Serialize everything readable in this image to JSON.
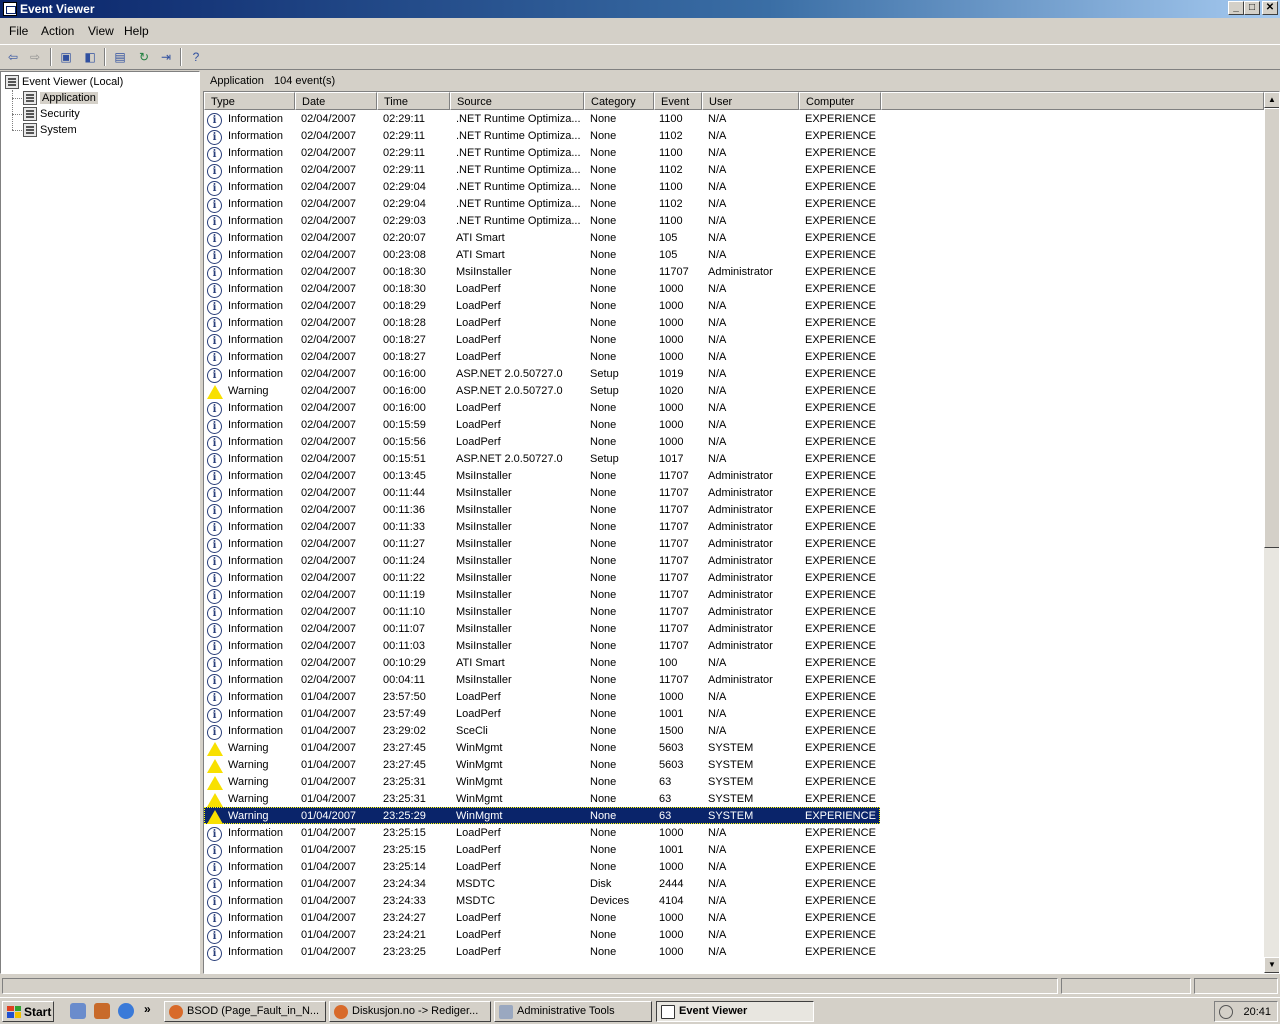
{
  "window": {
    "title": "Event Viewer",
    "min": "_",
    "max": "□",
    "close": "✕"
  },
  "menu": [
    "File",
    "Action",
    "View",
    "Help"
  ],
  "tree": {
    "root": "Event Viewer (Local)",
    "items": [
      "Application",
      "Security",
      "System"
    ],
    "selected": "Application"
  },
  "header": {
    "log": "Application",
    "count": "104 event(s)"
  },
  "columns": [
    "Type",
    "Date",
    "Time",
    "Source",
    "Category",
    "Event",
    "User",
    "Computer"
  ],
  "events": [
    [
      "Information",
      "02/04/2007",
      "02:29:11",
      ".NET Runtime Optimiza...",
      "None",
      "1100",
      "N/A",
      "EXPERIENCE"
    ],
    [
      "Information",
      "02/04/2007",
      "02:29:11",
      ".NET Runtime Optimiza...",
      "None",
      "1102",
      "N/A",
      "EXPERIENCE"
    ],
    [
      "Information",
      "02/04/2007",
      "02:29:11",
      ".NET Runtime Optimiza...",
      "None",
      "1100",
      "N/A",
      "EXPERIENCE"
    ],
    [
      "Information",
      "02/04/2007",
      "02:29:11",
      ".NET Runtime Optimiza...",
      "None",
      "1102",
      "N/A",
      "EXPERIENCE"
    ],
    [
      "Information",
      "02/04/2007",
      "02:29:04",
      ".NET Runtime Optimiza...",
      "None",
      "1100",
      "N/A",
      "EXPERIENCE"
    ],
    [
      "Information",
      "02/04/2007",
      "02:29:04",
      ".NET Runtime Optimiza...",
      "None",
      "1102",
      "N/A",
      "EXPERIENCE"
    ],
    [
      "Information",
      "02/04/2007",
      "02:29:03",
      ".NET Runtime Optimiza...",
      "None",
      "1100",
      "N/A",
      "EXPERIENCE"
    ],
    [
      "Information",
      "02/04/2007",
      "02:20:07",
      "ATI Smart",
      "None",
      "105",
      "N/A",
      "EXPERIENCE"
    ],
    [
      "Information",
      "02/04/2007",
      "00:23:08",
      "ATI Smart",
      "None",
      "105",
      "N/A",
      "EXPERIENCE"
    ],
    [
      "Information",
      "02/04/2007",
      "00:18:30",
      "MsiInstaller",
      "None",
      "11707",
      "Administrator",
      "EXPERIENCE"
    ],
    [
      "Information",
      "02/04/2007",
      "00:18:30",
      "LoadPerf",
      "None",
      "1000",
      "N/A",
      "EXPERIENCE"
    ],
    [
      "Information",
      "02/04/2007",
      "00:18:29",
      "LoadPerf",
      "None",
      "1000",
      "N/A",
      "EXPERIENCE"
    ],
    [
      "Information",
      "02/04/2007",
      "00:18:28",
      "LoadPerf",
      "None",
      "1000",
      "N/A",
      "EXPERIENCE"
    ],
    [
      "Information",
      "02/04/2007",
      "00:18:27",
      "LoadPerf",
      "None",
      "1000",
      "N/A",
      "EXPERIENCE"
    ],
    [
      "Information",
      "02/04/2007",
      "00:18:27",
      "LoadPerf",
      "None",
      "1000",
      "N/A",
      "EXPERIENCE"
    ],
    [
      "Information",
      "02/04/2007",
      "00:16:00",
      "ASP.NET 2.0.50727.0",
      "Setup",
      "1019",
      "N/A",
      "EXPERIENCE"
    ],
    [
      "Warning",
      "02/04/2007",
      "00:16:00",
      "ASP.NET 2.0.50727.0",
      "Setup",
      "1020",
      "N/A",
      "EXPERIENCE"
    ],
    [
      "Information",
      "02/04/2007",
      "00:16:00",
      "LoadPerf",
      "None",
      "1000",
      "N/A",
      "EXPERIENCE"
    ],
    [
      "Information",
      "02/04/2007",
      "00:15:59",
      "LoadPerf",
      "None",
      "1000",
      "N/A",
      "EXPERIENCE"
    ],
    [
      "Information",
      "02/04/2007",
      "00:15:56",
      "LoadPerf",
      "None",
      "1000",
      "N/A",
      "EXPERIENCE"
    ],
    [
      "Information",
      "02/04/2007",
      "00:15:51",
      "ASP.NET 2.0.50727.0",
      "Setup",
      "1017",
      "N/A",
      "EXPERIENCE"
    ],
    [
      "Information",
      "02/04/2007",
      "00:13:45",
      "MsiInstaller",
      "None",
      "11707",
      "Administrator",
      "EXPERIENCE"
    ],
    [
      "Information",
      "02/04/2007",
      "00:11:44",
      "MsiInstaller",
      "None",
      "11707",
      "Administrator",
      "EXPERIENCE"
    ],
    [
      "Information",
      "02/04/2007",
      "00:11:36",
      "MsiInstaller",
      "None",
      "11707",
      "Administrator",
      "EXPERIENCE"
    ],
    [
      "Information",
      "02/04/2007",
      "00:11:33",
      "MsiInstaller",
      "None",
      "11707",
      "Administrator",
      "EXPERIENCE"
    ],
    [
      "Information",
      "02/04/2007",
      "00:11:27",
      "MsiInstaller",
      "None",
      "11707",
      "Administrator",
      "EXPERIENCE"
    ],
    [
      "Information",
      "02/04/2007",
      "00:11:24",
      "MsiInstaller",
      "None",
      "11707",
      "Administrator",
      "EXPERIENCE"
    ],
    [
      "Information",
      "02/04/2007",
      "00:11:22",
      "MsiInstaller",
      "None",
      "11707",
      "Administrator",
      "EXPERIENCE"
    ],
    [
      "Information",
      "02/04/2007",
      "00:11:19",
      "MsiInstaller",
      "None",
      "11707",
      "Administrator",
      "EXPERIENCE"
    ],
    [
      "Information",
      "02/04/2007",
      "00:11:10",
      "MsiInstaller",
      "None",
      "11707",
      "Administrator",
      "EXPERIENCE"
    ],
    [
      "Information",
      "02/04/2007",
      "00:11:07",
      "MsiInstaller",
      "None",
      "11707",
      "Administrator",
      "EXPERIENCE"
    ],
    [
      "Information",
      "02/04/2007",
      "00:11:03",
      "MsiInstaller",
      "None",
      "11707",
      "Administrator",
      "EXPERIENCE"
    ],
    [
      "Information",
      "02/04/2007",
      "00:10:29",
      "ATI Smart",
      "None",
      "100",
      "N/A",
      "EXPERIENCE"
    ],
    [
      "Information",
      "02/04/2007",
      "00:04:11",
      "MsiInstaller",
      "None",
      "11707",
      "Administrator",
      "EXPERIENCE"
    ],
    [
      "Information",
      "01/04/2007",
      "23:57:50",
      "LoadPerf",
      "None",
      "1000",
      "N/A",
      "EXPERIENCE"
    ],
    [
      "Information",
      "01/04/2007",
      "23:57:49",
      "LoadPerf",
      "None",
      "1001",
      "N/A",
      "EXPERIENCE"
    ],
    [
      "Information",
      "01/04/2007",
      "23:29:02",
      "SceCli",
      "None",
      "1500",
      "N/A",
      "EXPERIENCE"
    ],
    [
      "Warning",
      "01/04/2007",
      "23:27:45",
      "WinMgmt",
      "None",
      "5603",
      "SYSTEM",
      "EXPERIENCE"
    ],
    [
      "Warning",
      "01/04/2007",
      "23:27:45",
      "WinMgmt",
      "None",
      "5603",
      "SYSTEM",
      "EXPERIENCE"
    ],
    [
      "Warning",
      "01/04/2007",
      "23:25:31",
      "WinMgmt",
      "None",
      "63",
      "SYSTEM",
      "EXPERIENCE"
    ],
    [
      "Warning",
      "01/04/2007",
      "23:25:31",
      "WinMgmt",
      "None",
      "63",
      "SYSTEM",
      "EXPERIENCE"
    ],
    [
      "Warning",
      "01/04/2007",
      "23:25:29",
      "WinMgmt",
      "None",
      "63",
      "SYSTEM",
      "EXPERIENCE"
    ],
    [
      "Information",
      "01/04/2007",
      "23:25:15",
      "LoadPerf",
      "None",
      "1000",
      "N/A",
      "EXPERIENCE"
    ],
    [
      "Information",
      "01/04/2007",
      "23:25:15",
      "LoadPerf",
      "None",
      "1001",
      "N/A",
      "EXPERIENCE"
    ],
    [
      "Information",
      "01/04/2007",
      "23:25:14",
      "LoadPerf",
      "None",
      "1000",
      "N/A",
      "EXPERIENCE"
    ],
    [
      "Information",
      "01/04/2007",
      "23:24:34",
      "MSDTC",
      "Disk",
      "2444",
      "N/A",
      "EXPERIENCE"
    ],
    [
      "Information",
      "01/04/2007",
      "23:24:33",
      "MSDTC",
      "Devices",
      "4104",
      "N/A",
      "EXPERIENCE"
    ],
    [
      "Information",
      "01/04/2007",
      "23:24:27",
      "LoadPerf",
      "None",
      "1000",
      "N/A",
      "EXPERIENCE"
    ],
    [
      "Information",
      "01/04/2007",
      "23:24:21",
      "LoadPerf",
      "None",
      "1000",
      "N/A",
      "EXPERIENCE"
    ],
    [
      "Information",
      "01/04/2007",
      "23:23:25",
      "LoadPerf",
      "None",
      "1000",
      "N/A",
      "EXPERIENCE"
    ]
  ],
  "selected_row": 41,
  "taskbar": {
    "start": "Start",
    "chevron": "»",
    "tasks": [
      "BSOD (Page_Fault_in_N...",
      "Diskusjon.no -> Rediger...",
      "Administrative Tools",
      "Event Viewer"
    ],
    "active_task": 3,
    "clock": "20:41"
  },
  "colors": {
    "title_active": "#0a246a",
    "selection": "#0a246a",
    "warning": "#f8e000",
    "face": "#d4d0c8"
  }
}
